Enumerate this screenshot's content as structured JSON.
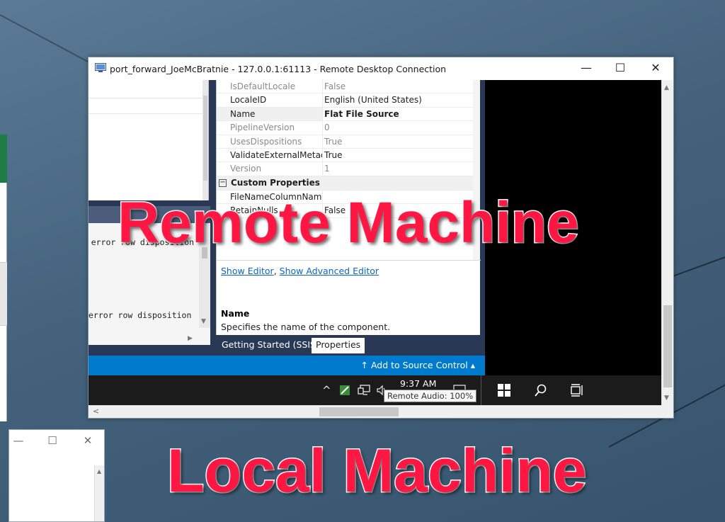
{
  "rdp_window": {
    "title": "port_forward_JoeMcBratnie - 127.0.0.1:61113 - Remote Desktop Connection",
    "minimize_glyph": "—",
    "maximize_glyph": "☐",
    "close_glyph": "✕"
  },
  "properties": {
    "rows": [
      {
        "name": "IsDefaultLocale",
        "value": "False",
        "style": "dim"
      },
      {
        "name": "LocaleID",
        "value": "English (United States)",
        "style": "normal"
      },
      {
        "name": "Name",
        "value": "Flat File Source",
        "style": "bold"
      },
      {
        "name": "PipelineVersion",
        "value": "0",
        "style": "dim"
      },
      {
        "name": "UsesDispositions",
        "value": "True",
        "style": "dim"
      },
      {
        "name": "ValidateExternalMetadata",
        "value": "True",
        "style": "normal"
      },
      {
        "name": "Version",
        "value": "1",
        "style": "dim"
      }
    ],
    "category_label": "Custom Properties",
    "custom_rows": [
      {
        "name": "FileNameColumnName",
        "value": ""
      },
      {
        "name": "RetainNulls",
        "value": "False"
      }
    ],
    "show_editor_link": "Show Editor",
    "link_separator": ", ",
    "show_advanced_link": "Show Advanced Editor",
    "description_title": "Name",
    "description_text": "Specifies the name of the component."
  },
  "output_pane": {
    "line_1": "ude error row disposition",
    "line_2": "error row disposition"
  },
  "tabs": [
    "Getting Started (SSIS)",
    "Properties"
  ],
  "statusbar": {
    "source_control": "↑  Add to Source Control ▴"
  },
  "taskbar": {
    "chevron": "^",
    "time": "9:37 AM",
    "tooltip": "Remote Audio: 100%",
    "start_icon": "windows-logo",
    "search_icon": "search",
    "taskview_icon": "task-view"
  },
  "overlay": {
    "remote_label": "Remote Machine",
    "local_label": "Local Machine",
    "color": "#ff1744"
  }
}
